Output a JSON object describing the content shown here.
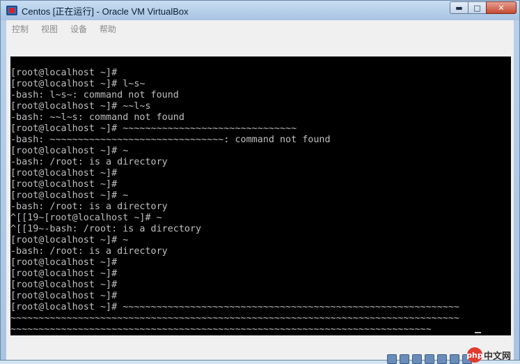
{
  "window": {
    "title": "Centos [正在运行] - Oracle VM VirtualBox",
    "minimize_glyph": "▬",
    "maximize_glyph": "□",
    "close_glyph": "✕"
  },
  "menu": {
    "items": [
      "控制",
      "视图",
      "设备",
      "帮助"
    ]
  },
  "console": {
    "lines": [
      "[root@localhost ~]#",
      "[root@localhost ~]# l~s~",
      "-bash: l~s~: command not found",
      "[root@localhost ~]# ~~l~s",
      "-bash: ~~l~s: command not found",
      "[root@localhost ~]# ~~~~~~~~~~~~~~~~~~~~~~~~~~~~~~~",
      "-bash: ~~~~~~~~~~~~~~~~~~~~~~~~~~~~~~~: command not found",
      "[root@localhost ~]# ~",
      "-bash: /root: is a directory",
      "[root@localhost ~]#",
      "[root@localhost ~]#",
      "[root@localhost ~]# ~",
      "-bash: /root: is a directory",
      "^[[19~[root@localhost ~]# ~",
      "^[[19~-bash: /root: is a directory",
      "[root@localhost ~]# ~",
      "-bash: /root: is a directory",
      "[root@localhost ~]#",
      "[root@localhost ~]#",
      "[root@localhost ~]#",
      "[root@localhost ~]#",
      "[root@localhost ~]# ~~~~~~~~~~~~~~~~~~~~~~~~~~~~~~~~~~~~~~~~~~~~~~~~~~~~~~~~~~~~",
      "~~~~~~~~~~~~~~~~~~~~~~~~~~~~~~~~~~~~~~~~~~~~~~~~~~~~~~~~~~~~~~~~~~~~~~~~~~~~~~~~",
      "~~~~~~~~~~~~~~~~~~~~~~~~~~~~~~~~~~~~~~~~~~~~~~~~~~~~~~~~~~~~~~~~~~~~~~~~~~~"
    ]
  },
  "status": {
    "watermark_icon": "php",
    "watermark_text": "中文网"
  },
  "colors": {
    "console_bg": "#000000",
    "console_fg": "#bfbfbf",
    "titlebar": "#b6cfe9",
    "close_button": "#c44a33"
  }
}
